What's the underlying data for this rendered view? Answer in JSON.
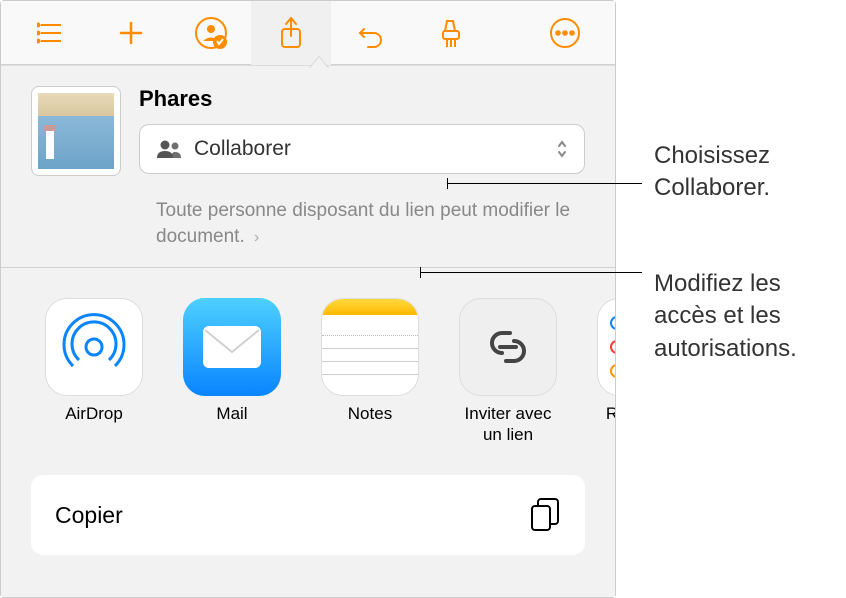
{
  "toolbar": {
    "panel_icon": "toc-icon",
    "add_icon": "plus-icon",
    "collab_icon": "people-badge-icon",
    "share_icon": "share-icon",
    "undo_icon": "undo-icon",
    "format_icon": "paintbrush-icon",
    "more_icon": "more-icon"
  },
  "share": {
    "doc_title": "Phares",
    "collab_label": "Collaborer",
    "note_text": "Toute personne disposant du lien peut modifier le document.",
    "apps": [
      {
        "label": "AirDrop",
        "icon": "airdrop-icon"
      },
      {
        "label": "Mail",
        "icon": "mail-icon"
      },
      {
        "label": "Notes",
        "icon": "notes-icon"
      },
      {
        "label": "Inviter avec un lien",
        "icon": "link-icon"
      },
      {
        "label": "R",
        "icon": "reminders-icon"
      }
    ],
    "copy_label": "Copier"
  },
  "callouts": {
    "collab": "Choisissez Collaborer.",
    "access": "Modifiez les accès et les autorisations."
  }
}
